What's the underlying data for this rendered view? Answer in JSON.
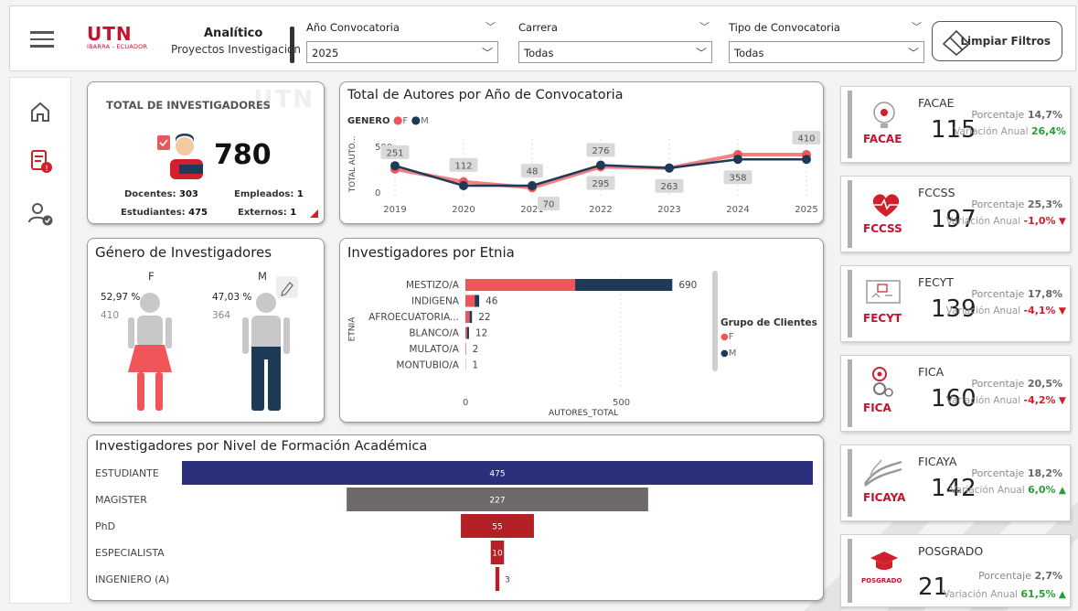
{
  "header": {
    "brand_logo": "UTN",
    "brand_logo_sub": "IBARRA - ECUADOR",
    "brand_title": "Analítico",
    "brand_subtitle": "Proyectos Investigación",
    "filters": [
      {
        "label": "Año Convocatoria",
        "value": "2025"
      },
      {
        "label": "Carrera",
        "value": "Todas"
      },
      {
        "label": "Tipo de Convocatoria",
        "value": "Todas"
      }
    ],
    "clear_label": "Limpiar Filtros"
  },
  "nav": {
    "items": [
      "home-icon",
      "report-alert-icon",
      "users-check-icon"
    ]
  },
  "kpi": {
    "title": "TOTAL DE INVESTIGADORES",
    "total": "780",
    "docentes_label": "Docentes:",
    "docentes": "303",
    "empleados_label": "Empleados:",
    "empleados": "1",
    "estudiantes_label": "Estudiantes:",
    "estudiantes": "475",
    "externos_label": "Externos:",
    "externos": "1"
  },
  "gender": {
    "title": "Género de Investigadores",
    "f_label": "F",
    "m_label": "M",
    "f_pct": "52,97 %",
    "m_pct": "47,03 %",
    "f_count": "410",
    "m_count": "364"
  },
  "colors": {
    "f": "#f0555a",
    "m": "#1d3a57",
    "accent": "#c8102e"
  },
  "chart_data": [
    {
      "type": "line",
      "title": "Total de Autores por Año de Convocatoria",
      "legend_title": "GENERO",
      "ylabel": "TOTAL AUTO...",
      "ylim": [
        0,
        500
      ],
      "yticks": [
        "500",
        "0"
      ],
      "x": [
        "2019",
        "2020",
        "2021",
        "2022",
        "2023",
        "2024",
        "2025"
      ],
      "series": [
        {
          "name": "F",
          "values": [
            251,
            112,
            48,
            276,
            263,
            410,
            410
          ]
        },
        {
          "name": "M",
          "values": [
            288,
            70,
            70,
            295,
            263,
            358,
            358
          ]
        }
      ],
      "labels_f": [
        "251",
        "112",
        "48",
        "276",
        "",
        "",
        "410"
      ],
      "labels_m": [
        "",
        "",
        "70",
        "295",
        "263",
        "358",
        ""
      ]
    },
    {
      "type": "bar",
      "title": "Investigadores por Etnia",
      "ylabel": "ETNIA",
      "xlabel": "AUTORES_TOTAL",
      "legend_title": "Grupo de Clientes",
      "xticks": [
        "0",
        "500"
      ],
      "categories": [
        "MESTIZO/A",
        "INDIGENA",
        "AFROECUATORIA...",
        "BLANCO/A",
        "MULATO/A",
        "MONTUBIO/A"
      ],
      "totals": [
        "690",
        "46",
        "22",
        "12",
        "2",
        "1"
      ],
      "series": [
        {
          "name": "F",
          "values": [
            366,
            31,
            14,
            6,
            2,
            1
          ]
        },
        {
          "name": "M",
          "values": [
            324,
            15,
            8,
            6,
            0,
            0
          ]
        }
      ]
    },
    {
      "type": "bar",
      "title": "Investigadores por Nivel de Formación Académica",
      "categories": [
        "ESTUDIANTE",
        "MAGISTER",
        "PhD",
        "ESPECIALISTA",
        "INGENIERO (A)"
      ],
      "values": [
        475,
        227,
        55,
        10,
        3
      ],
      "labels": [
        "475",
        "227",
        "55",
        "10",
        "3"
      ],
      "colors": [
        "#2b2f7c",
        "#6e6a6a",
        "#b51f26",
        "#b51f26",
        "#b51f26"
      ]
    }
  ],
  "faculties": [
    {
      "name": "FACAE",
      "code": "FACAE",
      "total": "115",
      "pct_label": "Porcentaje",
      "pct": "14,7%",
      "var_label": "Variación Anual",
      "var": "26,4%",
      "trend": "up"
    },
    {
      "name": "FCCSS",
      "code": "FCCSS",
      "total": "197",
      "pct_label": "Porcentaje",
      "pct": "25,3%",
      "var_label": "Variación Anual",
      "var": "-1,0%",
      "trend": "down"
    },
    {
      "name": "FECYT",
      "code": "FECYT",
      "total": "139",
      "pct_label": "Porcentaje",
      "pct": "17,8%",
      "var_label": "Variación Anual",
      "var": "-4,1%",
      "trend": "down"
    },
    {
      "name": "FICA",
      "code": "FICA",
      "total": "160",
      "pct_label": "Porcentaje",
      "pct": "20,5%",
      "var_label": "Variación Anual",
      "var": "-4,2%",
      "trend": "down"
    },
    {
      "name": "FICAYA",
      "code": "FICAYA",
      "total": "142",
      "pct_label": "Porcentaje",
      "pct": "18,2%",
      "var_label": "Variación Anual",
      "var": "6,0%",
      "trend": "up"
    },
    {
      "name": "POSGRADO",
      "code": "POSGRADO",
      "total": "21",
      "pct_label": "Porcentaje",
      "pct": "2,7%",
      "var_label": "Variación Anual",
      "var": "61,5%",
      "trend": "up"
    }
  ]
}
